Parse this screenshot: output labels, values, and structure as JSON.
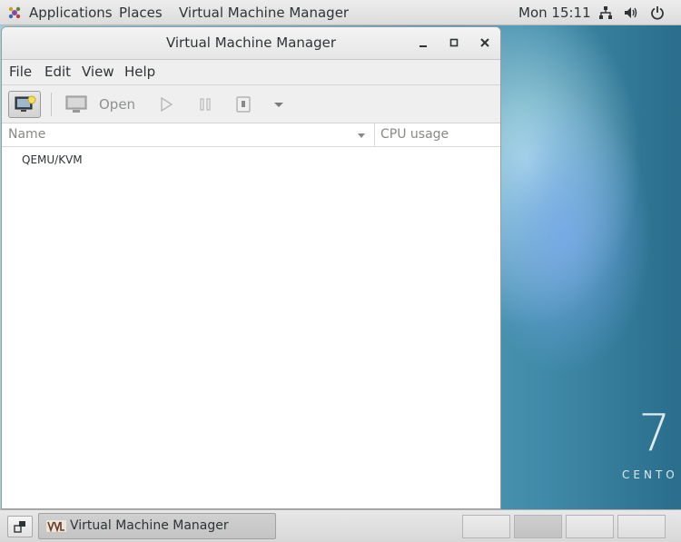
{
  "top_panel": {
    "applications": "Applications",
    "places": "Places",
    "active_app": "Virtual Machine Manager",
    "clock": "Mon 15:11",
    "icons": [
      "network-icon",
      "volume-icon",
      "power-icon"
    ]
  },
  "window": {
    "title": "Virtual Machine Manager",
    "controls": [
      "minimize-icon",
      "maximize-icon",
      "close-icon"
    ],
    "menu": [
      "File",
      "Edit",
      "View",
      "Help"
    ],
    "toolbar": {
      "open_label": "Open",
      "icons": [
        "new-vm-icon",
        "monitor-icon",
        "run-icon",
        "pause-icon",
        "shutdown-icon",
        "dropdown-arrow-icon"
      ]
    },
    "columns": {
      "name": "Name",
      "cpu": "CPU usage"
    },
    "rows": [
      {
        "name": "QEMU/KVM"
      }
    ]
  },
  "desktop": {
    "brand_number": "7",
    "brand_text": "CENTO"
  },
  "bottom_panel": {
    "task_label": "Virtual Machine Manager",
    "workspaces": 4,
    "active_workspace": 2
  },
  "colors": {
    "accent": "#2e3436",
    "disabled_text": "#8f9090",
    "desktop_blue": "#6fb2c8"
  }
}
